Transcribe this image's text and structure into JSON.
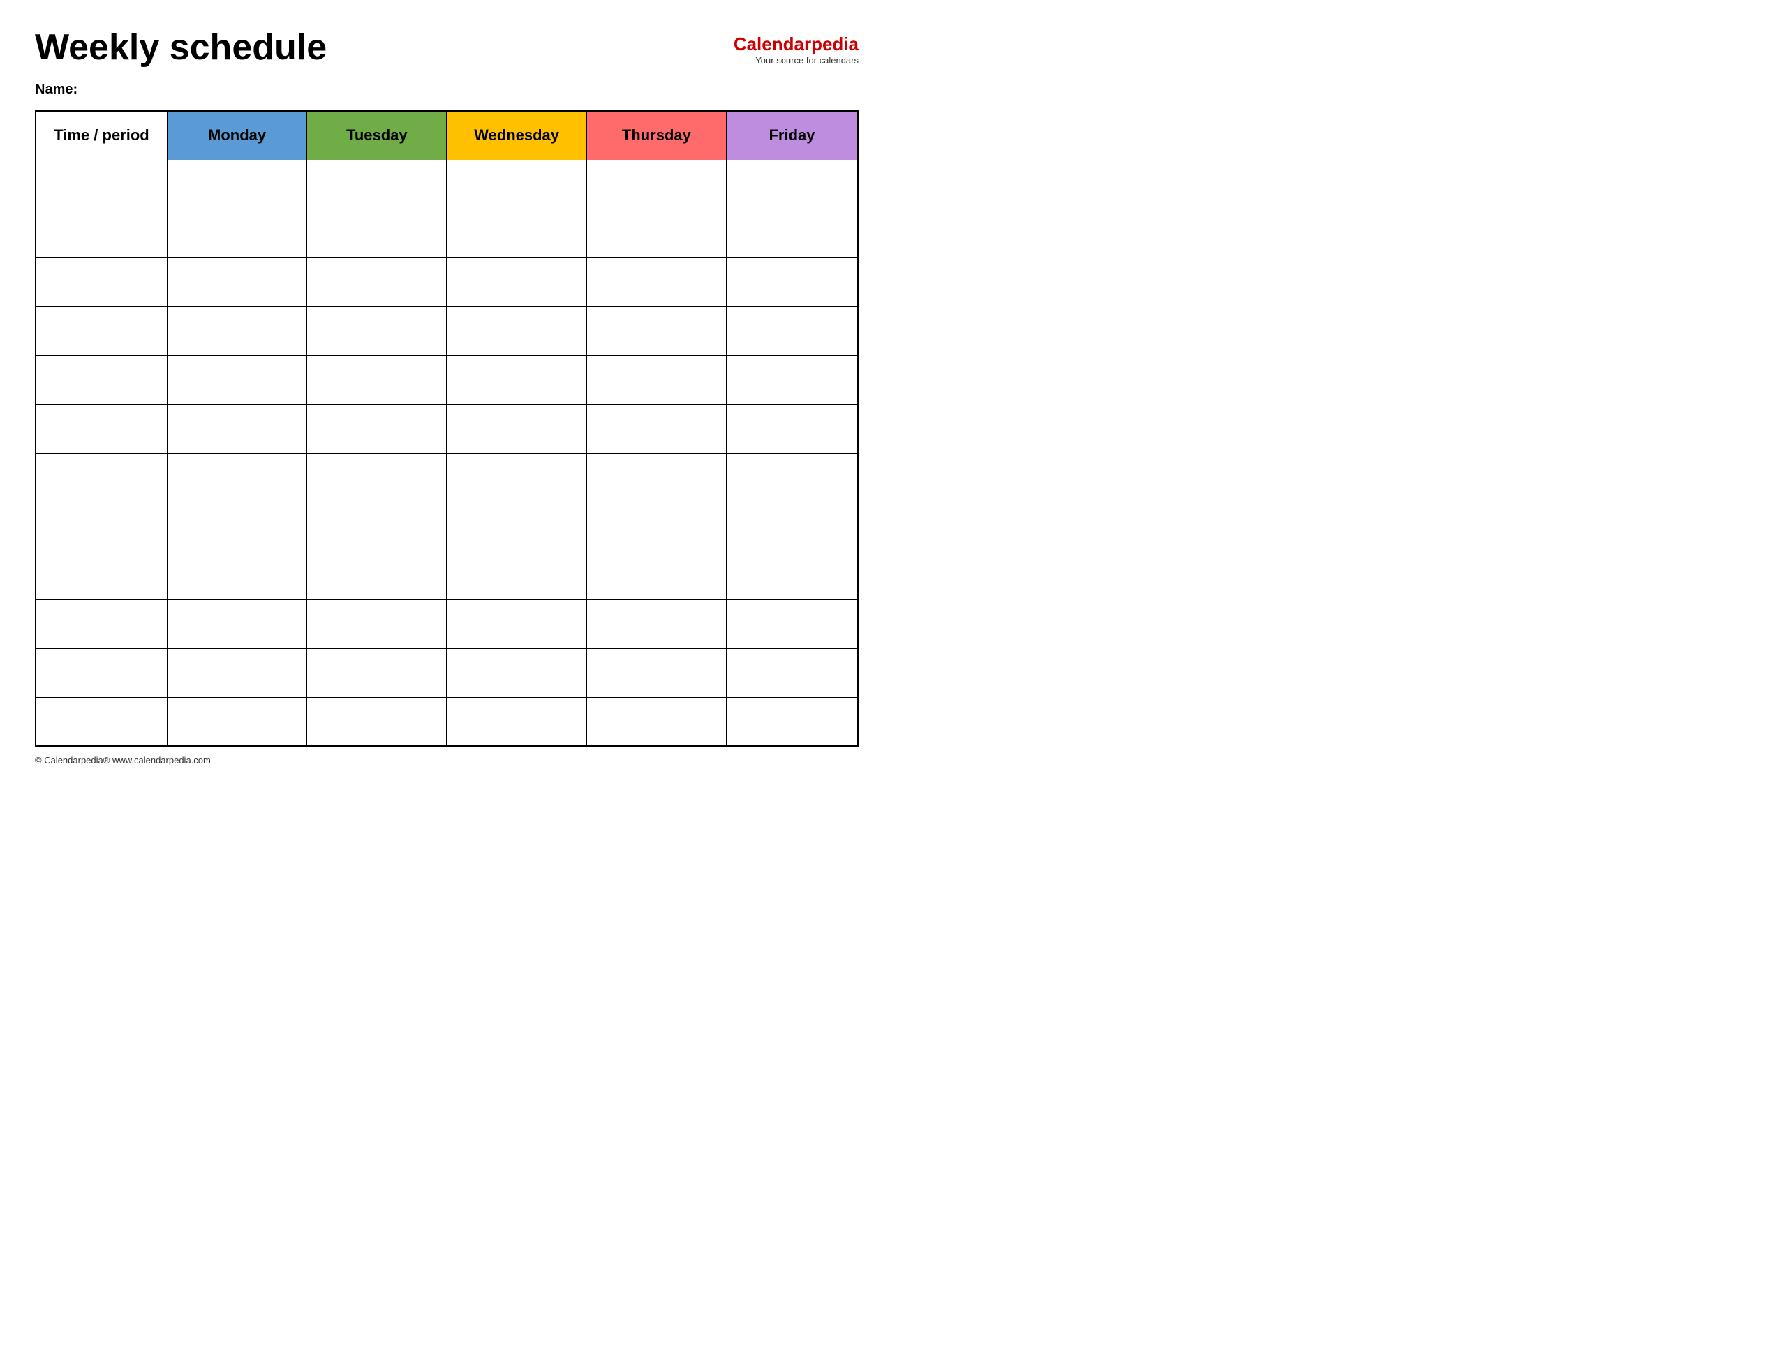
{
  "header": {
    "title": "Weekly schedule",
    "logo_calendar": "Calendar",
    "logo_pedia": "pedia",
    "logo_subtitle": "Your source for calendars"
  },
  "name_label": "Name:",
  "table": {
    "columns": [
      {
        "label": "Time / period",
        "class": "th-time"
      },
      {
        "label": "Monday",
        "class": "th-monday"
      },
      {
        "label": "Tuesday",
        "class": "th-tuesday"
      },
      {
        "label": "Wednesday",
        "class": "th-wednesday"
      },
      {
        "label": "Thursday",
        "class": "th-thursday"
      },
      {
        "label": "Friday",
        "class": "th-friday"
      }
    ],
    "row_count": 12
  },
  "footer": {
    "text": "© Calendarpedia®  www.calendarpedia.com"
  }
}
